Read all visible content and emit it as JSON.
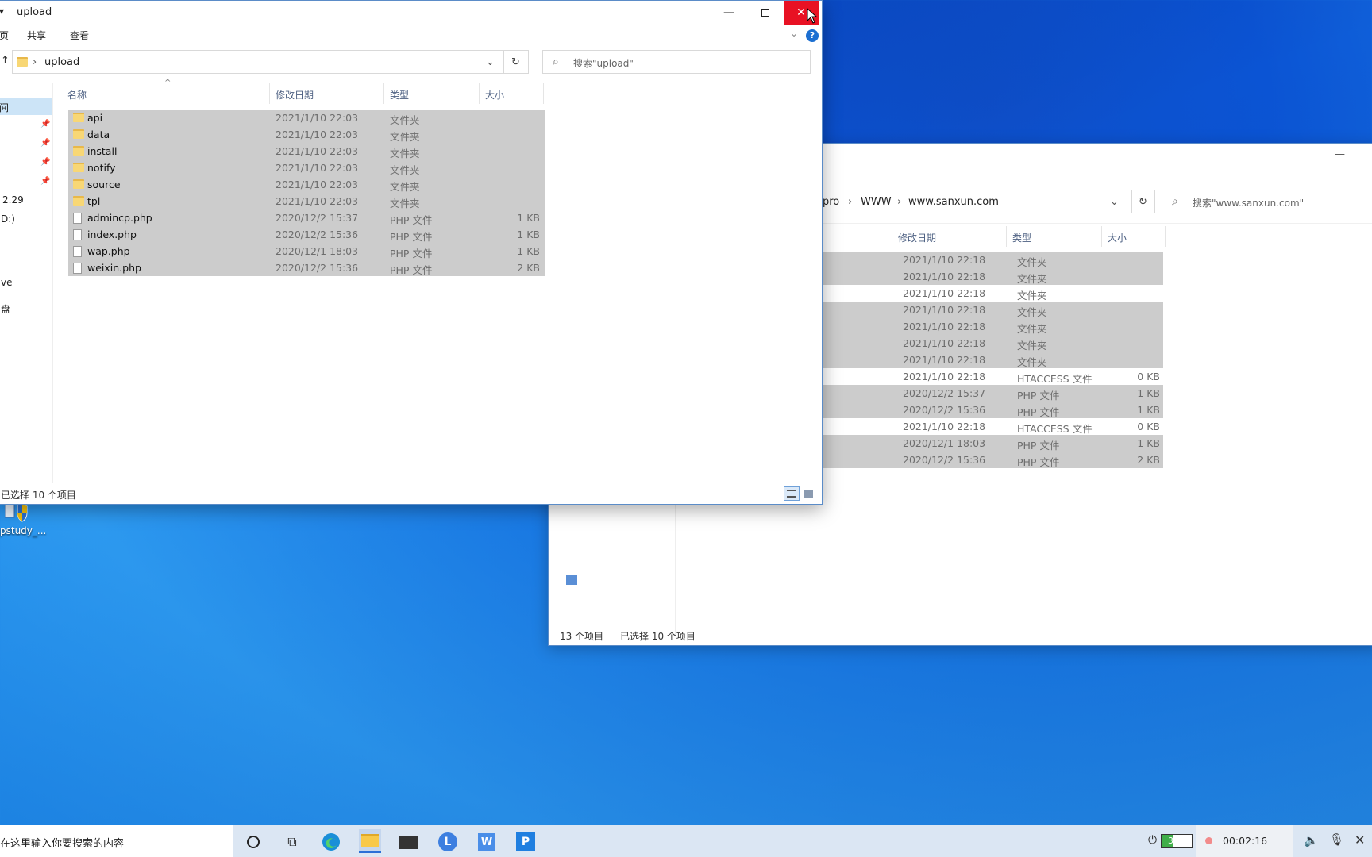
{
  "desktop": {
    "icon_label": "pstudy_..."
  },
  "main_window": {
    "title": "upload",
    "ribbon_tabs": [
      "页",
      "共享",
      "查看"
    ],
    "address_path": "upload",
    "search_placeholder": "搜索\"upload\"",
    "columns": [
      "名称",
      "修改日期",
      "类型",
      "大小"
    ],
    "nav_items": [
      "间",
      "2.29",
      "D:)",
      "ve",
      "盘"
    ],
    "rows": [
      {
        "name": "api",
        "date": "2021/1/10 22:03",
        "type": "文件夹",
        "size": "",
        "kind": "folder"
      },
      {
        "name": "data",
        "date": "2021/1/10 22:03",
        "type": "文件夹",
        "size": "",
        "kind": "folder"
      },
      {
        "name": "install",
        "date": "2021/1/10 22:03",
        "type": "文件夹",
        "size": "",
        "kind": "folder"
      },
      {
        "name": "notify",
        "date": "2021/1/10 22:03",
        "type": "文件夹",
        "size": "",
        "kind": "folder"
      },
      {
        "name": "source",
        "date": "2021/1/10 22:03",
        "type": "文件夹",
        "size": "",
        "kind": "folder"
      },
      {
        "name": "tpl",
        "date": "2021/1/10 22:03",
        "type": "文件夹",
        "size": "",
        "kind": "folder"
      },
      {
        "name": "admincp.php",
        "date": "2020/12/2 15:37",
        "type": "PHP 文件",
        "size": "1 KB",
        "kind": "file"
      },
      {
        "name": "index.php",
        "date": "2020/12/2 15:36",
        "type": "PHP 文件",
        "size": "1 KB",
        "kind": "file"
      },
      {
        "name": "wap.php",
        "date": "2020/12/1 18:03",
        "type": "PHP 文件",
        "size": "1 KB",
        "kind": "file"
      },
      {
        "name": "weixin.php",
        "date": "2020/12/2 15:36",
        "type": "PHP 文件",
        "size": "2 KB",
        "kind": "file"
      }
    ],
    "status_text": "已选择 10 个项目"
  },
  "back_window": {
    "breadcrumb": [
      "pro",
      "WWW",
      "www.sanxun.com"
    ],
    "search_placeholder": "搜索\"www.sanxun.com\"",
    "columns": [
      "修改日期",
      "类型",
      "大小"
    ],
    "rows": [
      {
        "date": "2021/1/10 22:18",
        "type": "文件夹",
        "size": "",
        "selected": true
      },
      {
        "date": "2021/1/10 22:18",
        "type": "文件夹",
        "size": "",
        "selected": true
      },
      {
        "date": "2021/1/10 22:18",
        "type": "文件夹",
        "size": "",
        "selected": false
      },
      {
        "date": "2021/1/10 22:18",
        "type": "文件夹",
        "size": "",
        "selected": true
      },
      {
        "date": "2021/1/10 22:18",
        "type": "文件夹",
        "size": "",
        "selected": true
      },
      {
        "date": "2021/1/10 22:18",
        "type": "文件夹",
        "size": "",
        "selected": true
      },
      {
        "date": "2021/1/10 22:18",
        "type": "文件夹",
        "size": "",
        "selected": true
      },
      {
        "date": "2021/1/10 22:18",
        "type": "HTACCESS 文件",
        "size": "0 KB",
        "selected": false
      },
      {
        "date": "2020/12/2 15:37",
        "type": "PHP 文件",
        "size": "1 KB",
        "selected": true
      },
      {
        "date": "2020/12/2 15:36",
        "type": "PHP 文件",
        "size": "1 KB",
        "selected": true
      },
      {
        "date": "2021/1/10 22:18",
        "type": "HTACCESS 文件",
        "size": "0 KB",
        "selected": false
      },
      {
        "date": "2020/12/1 18:03",
        "type": "PHP 文件",
        "size": "1 KB",
        "selected": true
      },
      {
        "date": "2020/12/2 15:36",
        "type": "PHP 文件",
        "size": "2 KB",
        "selected": true
      }
    ],
    "status_count": "13 个项目",
    "status_selected": "已选择 10 个项目"
  },
  "taskbar": {
    "search_text": "在这里输入你要搜索的内容",
    "battery_percent": "37%",
    "recording_time": "00:02:16"
  },
  "colors": {
    "selection": "#cccccc",
    "close_button": "#e81123",
    "folder": "#f8d775",
    "accent": "#1c6fd1"
  }
}
